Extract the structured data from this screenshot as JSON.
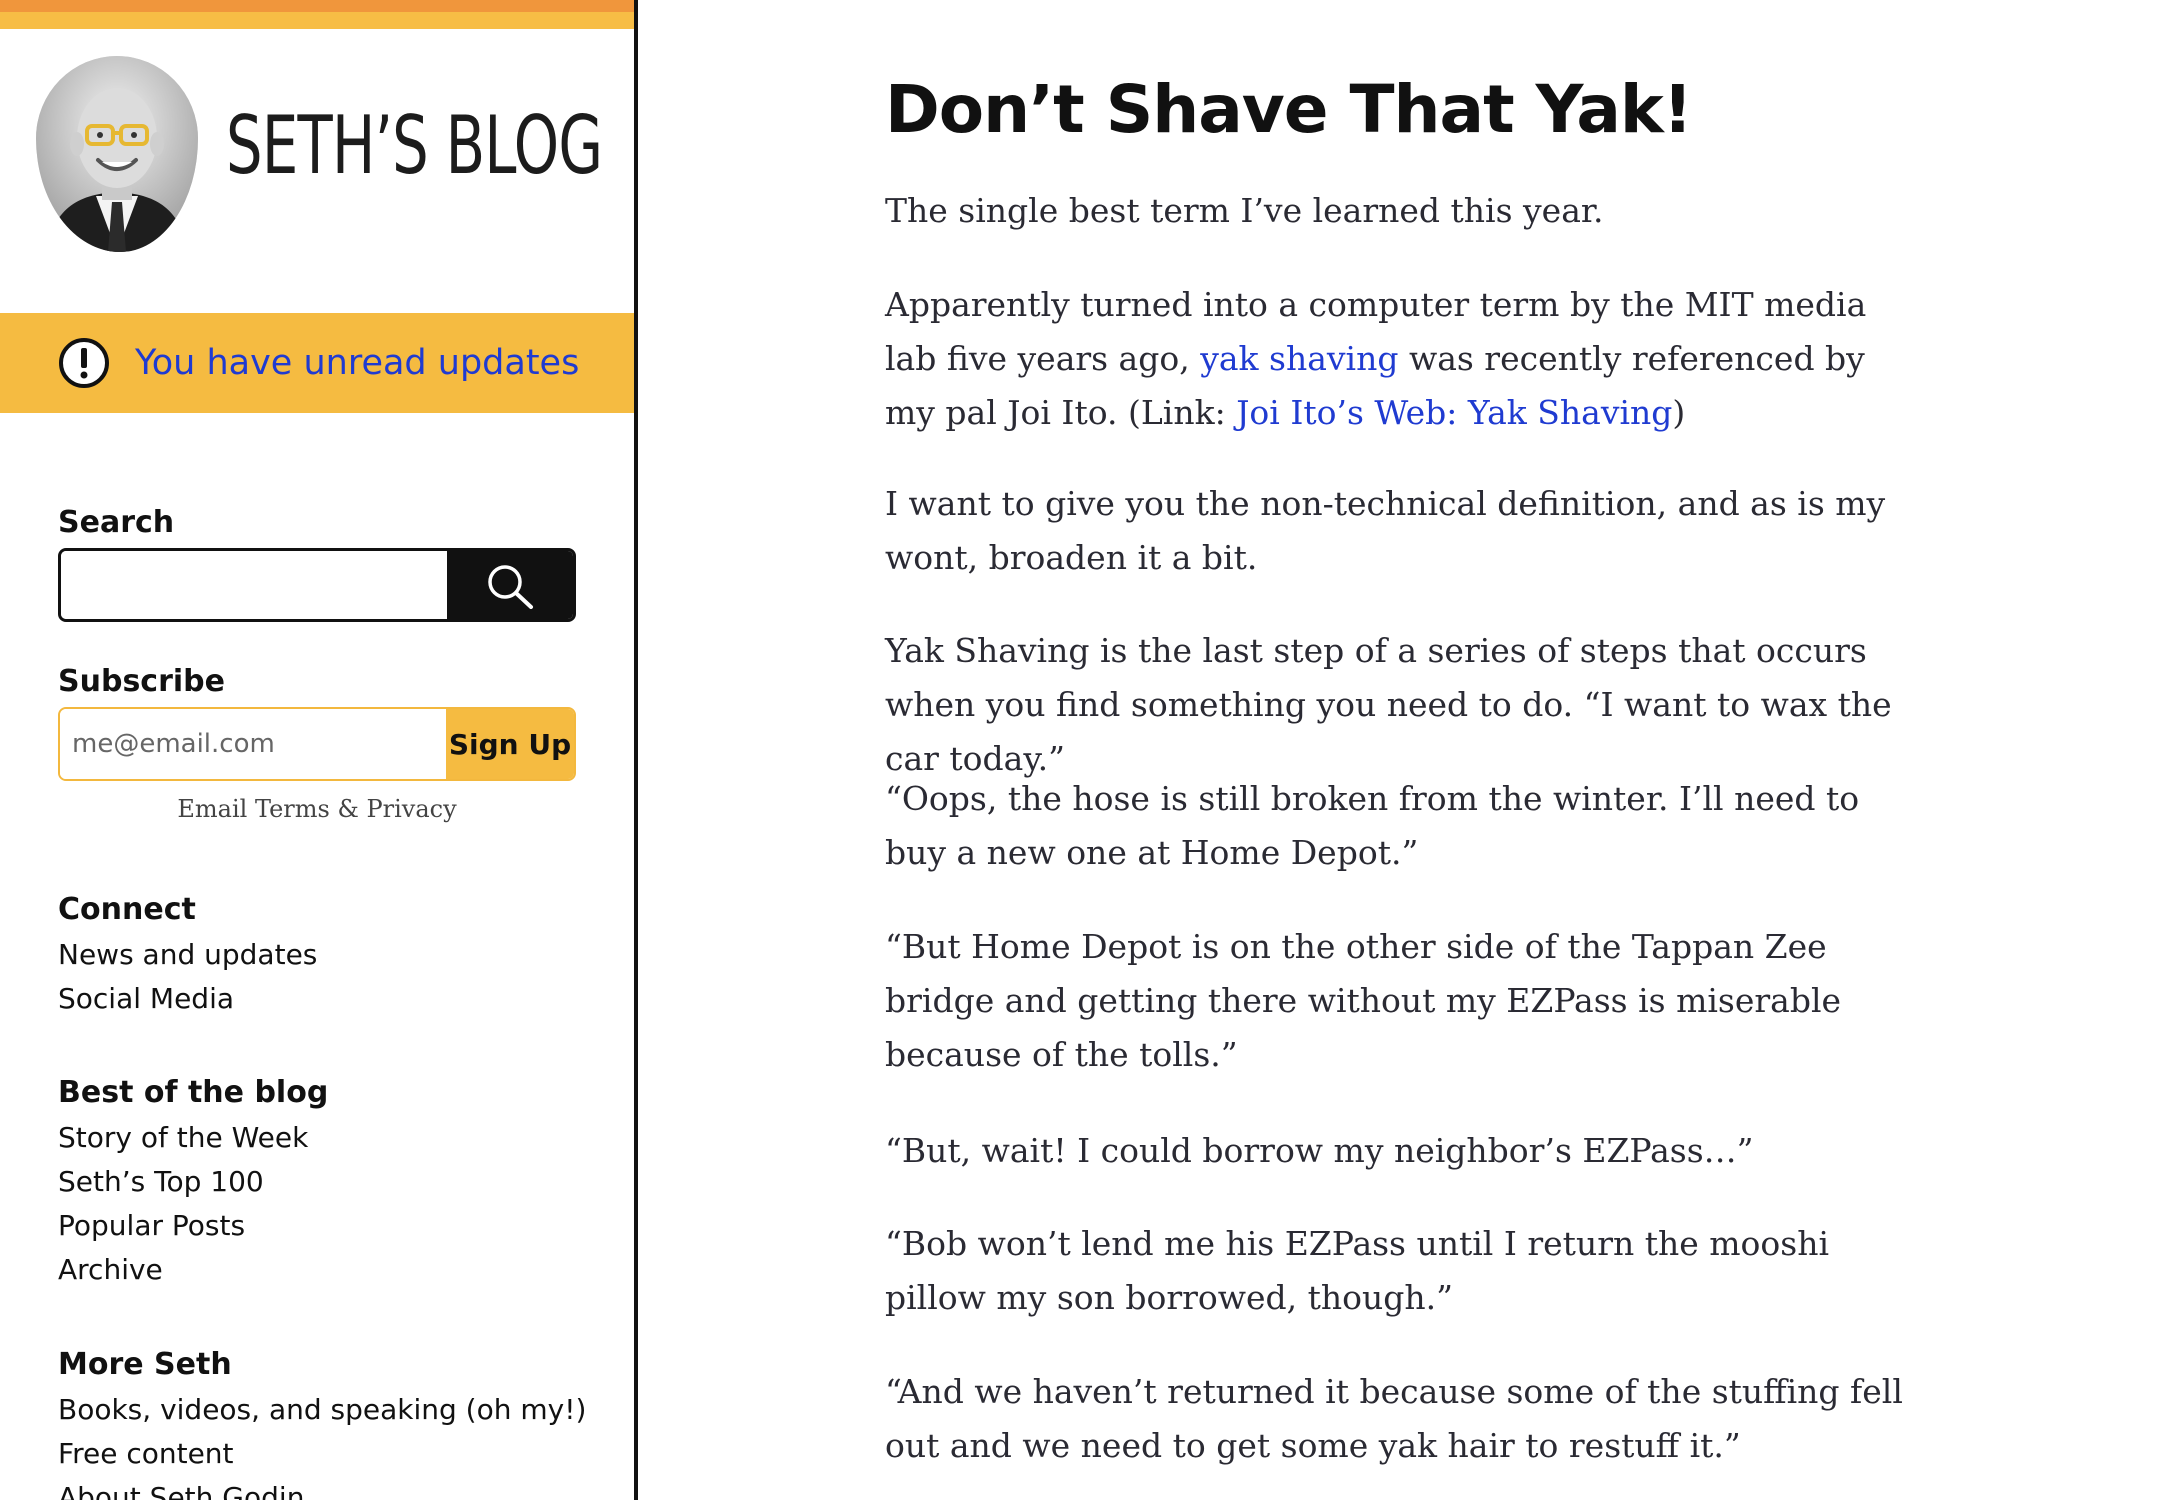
{
  "sidebar": {
    "site_title": "SETH’S BLOG",
    "unread_text": "You have unread updates",
    "search": {
      "heading": "Search",
      "value": "",
      "placeholder": ""
    },
    "subscribe": {
      "heading": "Subscribe",
      "placeholder": "me@email.com",
      "button_label": "Sign Up",
      "terms_text": "Email Terms & Privacy"
    },
    "connect": {
      "heading": "Connect",
      "items": [
        "News and updates",
        "Social Media"
      ]
    },
    "best": {
      "heading": "Best of the blog",
      "items": [
        "Story of the Week",
        "Seth’s Top 100",
        "Popular Posts",
        "Archive"
      ]
    },
    "more": {
      "heading": "More Seth",
      "items": [
        "Books, videos, and speaking (oh my!)",
        "Free content",
        "About Seth Godin"
      ]
    }
  },
  "post": {
    "title": "Don’t Shave That Yak!",
    "p1": "The single best term I’ve learned this year.",
    "p2_before": "Apparently turned into a computer term by the MIT media lab five years ago, ",
    "p2_link1": "yak shaving",
    "p2_mid": " was recently referenced by my pal Joi Ito. (Link: ",
    "p2_link2": "Joi Ito’s Web: Yak Shaving",
    "p2_after": ")",
    "p3": "I want to give you the non-technical definition, and as is my wont, broaden it a bit.",
    "p4": "Yak Shaving is the last step of a series of steps that occurs when you find something you need to do. “I want to wax the car today.”",
    "p5": "“Oops, the hose is still broken from the winter. I’ll need to buy a new one at Home Depot.”",
    "p6": "“But Home Depot is on the other side of the Tappan Zee bridge and getting there without my EZPass is miserable because of the tolls.”",
    "p7": "“But, wait! I could borrow my neighbor’s EZPass…”",
    "p8": "“Bob won’t lend me his EZPass until I return the mooshi pillow my son borrowed, though.”",
    "p9": "“And we haven’t returned it because some of the stuffing fell out and we need to get some yak hair to restuff it.”"
  },
  "colors": {
    "stripe_orange": "#f0963c",
    "stripe_yellow": "#f7bd45",
    "banner_yellow": "#f5bb41",
    "link_blue": "#1f3bd1",
    "text_dark": "#111111"
  },
  "icons": {
    "alert": "exclamation-circle-icon",
    "search": "magnifier-icon"
  }
}
